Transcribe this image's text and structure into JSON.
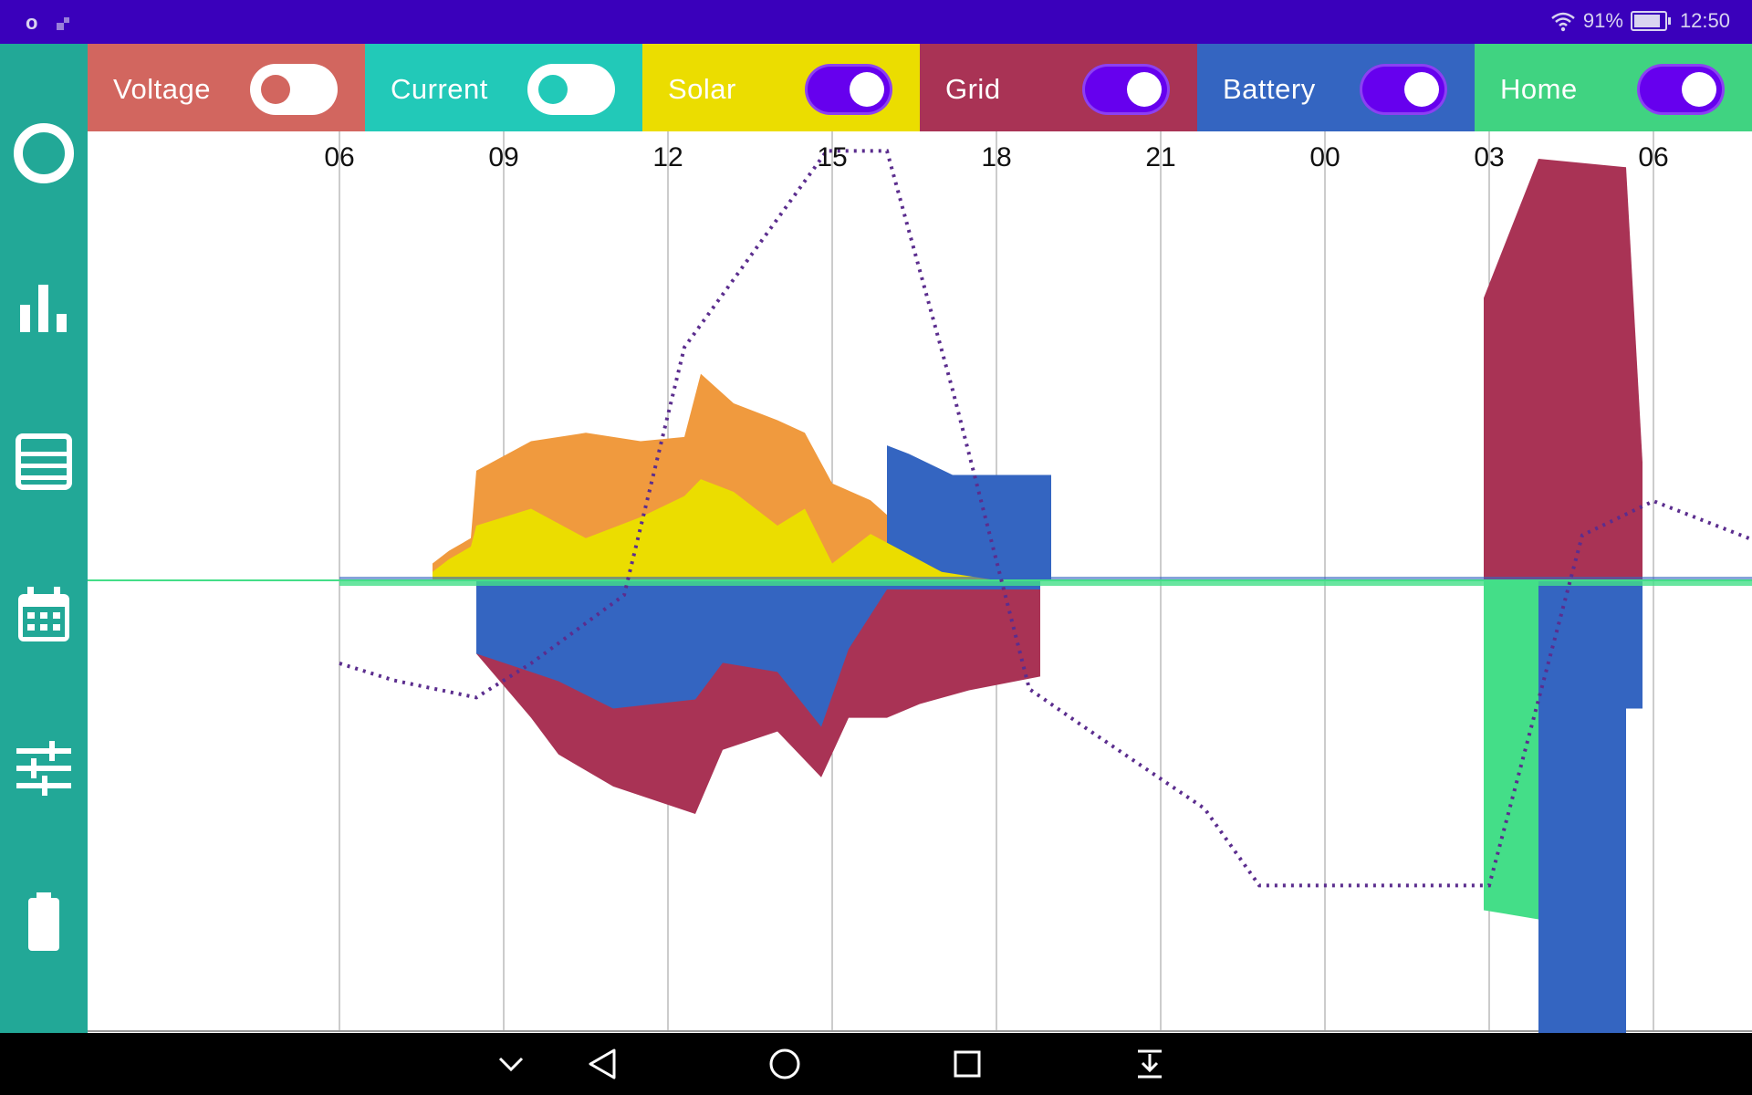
{
  "status_bar": {
    "left_text": "o",
    "battery": "91%",
    "time": "12:50",
    "icons": [
      "notification-icon",
      "wifi-icon",
      "battery-icon"
    ]
  },
  "sidebar": {
    "items": [
      {
        "icon": "circle-icon",
        "name": "live"
      },
      {
        "icon": "bar-chart-icon",
        "name": "stats"
      },
      {
        "icon": "list-icon",
        "name": "log"
      },
      {
        "icon": "calendar-icon",
        "name": "calendar"
      },
      {
        "icon": "sliders-icon",
        "name": "settings"
      },
      {
        "icon": "battery-icon",
        "name": "battery"
      }
    ]
  },
  "toggles": [
    {
      "label": "Voltage",
      "on": false,
      "color": "#d2665f"
    },
    {
      "label": "Current",
      "on": false,
      "color": "#22c9b8"
    },
    {
      "label": "Solar",
      "on": true,
      "color": "#ebdd00"
    },
    {
      "label": "Grid",
      "on": true,
      "color": "#a93355"
    },
    {
      "label": "Battery",
      "on": true,
      "color": "#3465c1"
    },
    {
      "label": "Home",
      "on": true,
      "color": "#40d381"
    }
  ],
  "colors": {
    "solar": "#ebdd00",
    "solar_home": "#f09a3e",
    "grid": "#a93355",
    "battery": "#3465c1",
    "home": "#44de88",
    "soc_line": "#5b2d8e",
    "sidebar": "#22a897",
    "statusbar": "#3a00bb"
  },
  "chart_data": {
    "type": "area",
    "x_tick_labels": [
      "06",
      "09",
      "12",
      "15",
      "18",
      "21",
      "00",
      "03",
      "06",
      "09",
      "12"
    ],
    "grid": true,
    "series_names": [
      "Solar",
      "Grid",
      "Battery",
      "Home"
    ],
    "soc_line": {
      "x_hours": [
        6.0,
        7.0,
        8.5,
        9.5,
        11.2,
        12.3,
        14.9,
        16.0,
        17.2,
        18.6,
        19.5,
        21.8,
        22.8,
        27.0,
        28.7,
        30.0,
        32.0,
        35.0,
        36.4,
        37.0
      ],
      "level": [
        0.39,
        0.37,
        0.35,
        0.39,
        0.47,
        0.76,
        0.99,
        0.99,
        0.71,
        0.36,
        0.32,
        0.22,
        0.13,
        0.13,
        0.54,
        0.58,
        0.53,
        0.53,
        0.64,
        0.77
      ]
    },
    "positive_regions": [
      {
        "series": "solar",
        "x": [
          7.7,
          8.0,
          8.4,
          8.5,
          9.5,
          10.5,
          11.5,
          12.3,
          12.6,
          13.2,
          14.0,
          14.5,
          15.0,
          15.7,
          17.0,
          18.0
        ],
        "y": [
          0.02,
          0.05,
          0.08,
          0.13,
          0.17,
          0.1,
          0.15,
          0.2,
          0.24,
          0.21,
          0.13,
          0.17,
          0.04,
          0.11,
          0.02,
          0.0
        ]
      },
      {
        "series": "solar_home",
        "x": [
          7.7,
          8.0,
          8.4,
          8.5,
          9.5,
          10.5,
          11.5,
          12.3,
          12.6,
          13.2,
          14.0,
          14.5,
          15.0,
          15.7,
          17.0,
          18.0
        ],
        "y": [
          0.04,
          0.07,
          0.1,
          0.26,
          0.33,
          0.35,
          0.33,
          0.34,
          0.49,
          0.42,
          0.38,
          0.35,
          0.23,
          0.19,
          0.04,
          0.0
        ]
      },
      {
        "series": "battery",
        "x": [
          16.0,
          16.4,
          17.2,
          19.0
        ],
        "y": [
          0.32,
          0.3,
          0.25,
          0.25
        ]
      },
      {
        "series": "grid",
        "x": [
          26.9,
          27.9,
          29.5,
          29.8
        ],
        "y": [
          0.67,
          1.0,
          0.98,
          0.28
        ]
      },
      {
        "series": "solar",
        "x": [
          32.0,
          33.5,
          34.8,
          35.3,
          35.8,
          36.0,
          37.0
        ],
        "y": [
          0.0,
          0.01,
          0.02,
          0.05,
          0.12,
          0.07,
          0.04
        ]
      },
      {
        "series": "solar_home",
        "x": [
          32.0,
          33.5,
          34.8,
          35.3,
          35.8,
          36.0,
          37.0
        ],
        "y": [
          0.0,
          0.02,
          0.04,
          0.12,
          0.45,
          0.15,
          0.12
        ]
      }
    ],
    "negative_regions": [
      {
        "series": "grid",
        "x": [
          8.5,
          9.5,
          10.0,
          11.0,
          12.5,
          13.0,
          14.0,
          14.8,
          15.3,
          16.0,
          16.6,
          17.5,
          18.8
        ],
        "y": [
          -0.16,
          -0.3,
          -0.38,
          -0.45,
          -0.51,
          -0.37,
          -0.33,
          -0.43,
          -0.3,
          -0.3,
          -0.27,
          -0.24,
          -0.21
        ]
      },
      {
        "series": "battery",
        "x": [
          8.5,
          9.5,
          10.0,
          11.0,
          12.5,
          13.0,
          14.0,
          14.8,
          15.3,
          16.0,
          16.6,
          17.5,
          18.8
        ],
        "y": [
          -0.16,
          -0.2,
          -0.22,
          -0.28,
          -0.26,
          -0.18,
          -0.2,
          -0.32,
          -0.15,
          -0.02,
          -0.02,
          -0.02,
          -0.02
        ]
      },
      {
        "series": "home",
        "x": [
          26.9,
          27.9,
          29.5
        ],
        "y": [
          -0.72,
          -0.74,
          -0.69
        ]
      },
      {
        "series": "battery",
        "x": [
          27.9,
          29.5
        ],
        "y": [
          -0.99,
          -0.99
        ]
      },
      {
        "series": "battery",
        "x": [
          29.5,
          29.8
        ],
        "y": [
          -0.28,
          -0.28
        ]
      },
      {
        "series": "battery",
        "x": [
          35.0,
          35.8,
          37.0
        ],
        "y": [
          -0.1,
          -0.21,
          -0.06
        ]
      }
    ]
  },
  "nav_bar": {
    "buttons": [
      "chevron-down-icon",
      "back-icon",
      "home-icon",
      "recents-icon",
      "notification-pull-icon"
    ]
  }
}
